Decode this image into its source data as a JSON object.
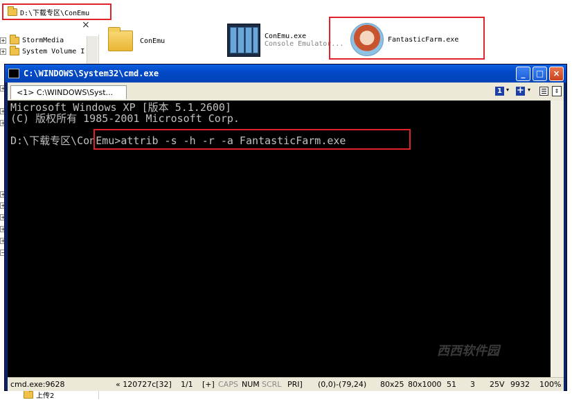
{
  "explorer": {
    "address": "D:\\下载专区\\ConEmu",
    "close_glyph": "×",
    "tree_items": [
      {
        "label": "StormMedia"
      },
      {
        "label": "System Volume I"
      }
    ],
    "bottom_folder": "上传2",
    "files": [
      {
        "name": "ConEmu",
        "desc": ""
      },
      {
        "name": "ConEmu.exe",
        "desc": "Console Emulator..."
      },
      {
        "name": "FantasticFarm.exe",
        "desc": ""
      }
    ]
  },
  "window": {
    "title": "C:\\WINDOWS\\System32\\cmd.exe",
    "buttons": {
      "minimize": "_",
      "maximize": "□",
      "close": "×"
    },
    "tab_label": "<1> C:\\WINDOWS\\Syst...",
    "tab_badge": "1",
    "tab_plus": "+",
    "dropdown_glyph": "▾",
    "scroll_glyph": "⇕"
  },
  "console": {
    "lines": [
      "Microsoft Windows XP [版本 5.1.2600]",
      "(C) 版权所有 1985-2001 Microsoft Corp.",
      "",
      "D:\\下载专区\\ConEmu>attrib -s -h -r -a FantasticFarm.exe"
    ],
    "watermark": "西西软件园"
  },
  "status": {
    "process": "cmd.exe:9628",
    "code": "« 120727c[32]",
    "tab_count": "1/1",
    "plus": "[+]",
    "caps": "CAPS",
    "num": "NUM",
    "scrl": "SCRL",
    "pri": "PRI]",
    "selection": "(0,0)-(79,24)",
    "size": "80x25",
    "buffer": "80x1000",
    "v1": "51",
    "v2": "3",
    "voltage": "25V",
    "v3": "9932",
    "zoom": "100%"
  },
  "colors": {
    "highlight": "#e0232a",
    "console_bg": "#000000",
    "console_fg": "#c0c0c0",
    "titlebar": "#0348c6"
  }
}
